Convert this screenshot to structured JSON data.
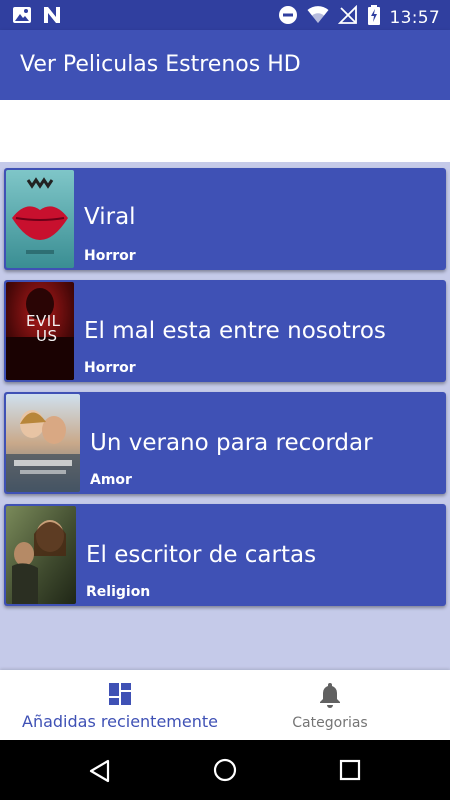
{
  "status_bar": {
    "time": "13:57",
    "icons": [
      "image-icon",
      "n-app-icon",
      "do-not-disturb-icon",
      "wifi-icon",
      "no-signal-icon",
      "battery-charging-icon"
    ]
  },
  "app_bar": {
    "title": "Ver Peliculas Estrenos HD"
  },
  "movies": [
    {
      "title": "Viral",
      "genre": "Horror",
      "poster_icon": "lips-poster"
    },
    {
      "title": "El mal esta entre nosotros",
      "genre": "Horror",
      "poster_icon": "evil-us-poster",
      "poster_text": "EVIL US"
    },
    {
      "title": "Un verano para recordar",
      "genre": "Amor",
      "poster_icon": "couple-poster"
    },
    {
      "title": "El escritor de cartas",
      "genre": "Religion",
      "poster_icon": "letter-writer-poster"
    }
  ],
  "bottom_nav": {
    "items": [
      {
        "label": "Añadidas recientemente",
        "icon": "dashboard-icon",
        "active": true
      },
      {
        "label": "Categorias",
        "icon": "bell-icon",
        "active": false
      }
    ]
  },
  "colors": {
    "primary": "#3f51b5",
    "primary_dark": "#303f9f",
    "list_background": "#c5cae9",
    "inactive": "#757575"
  }
}
